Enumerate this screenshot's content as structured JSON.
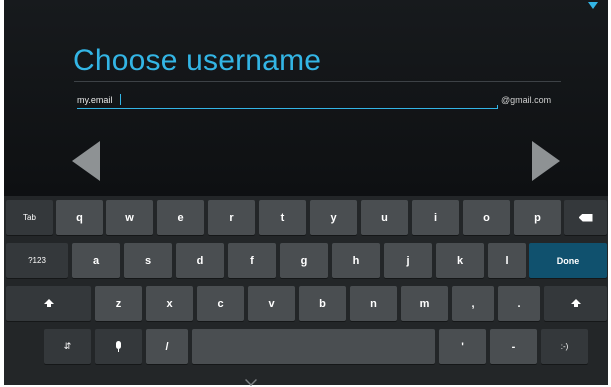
{
  "setup": {
    "title": "Choose username",
    "username_value": "my.email",
    "domain_suffix": "@gmail.com",
    "accent_color": "#33b5e5"
  },
  "navigation": {
    "back_icon": "chevron-left-icon",
    "next_icon": "chevron-right-icon"
  },
  "keyboard": {
    "row1": {
      "tab": "Tab",
      "letters": [
        "q",
        "w",
        "e",
        "r",
        "t",
        "y",
        "u",
        "i",
        "o",
        "p"
      ],
      "backspace_icon": "backspace-icon"
    },
    "row2": {
      "symbols": "?123",
      "letters": [
        "a",
        "s",
        "d",
        "f",
        "g",
        "h",
        "j",
        "k",
        "l"
      ],
      "done": "Done"
    },
    "row3": {
      "shift_icon": "shift-icon",
      "letters": [
        "z",
        "x",
        "c",
        "v",
        "b",
        "n",
        "m"
      ],
      "punctuation": [
        ",",
        "."
      ]
    },
    "row4": {
      "settings_icon": "keyboard-settings-icon",
      "mic_icon": "microphone-icon",
      "slash": "/",
      "quote": "'",
      "dash": "-",
      "smiley": ":-)"
    },
    "hide_icon": "chevron-down-icon"
  }
}
